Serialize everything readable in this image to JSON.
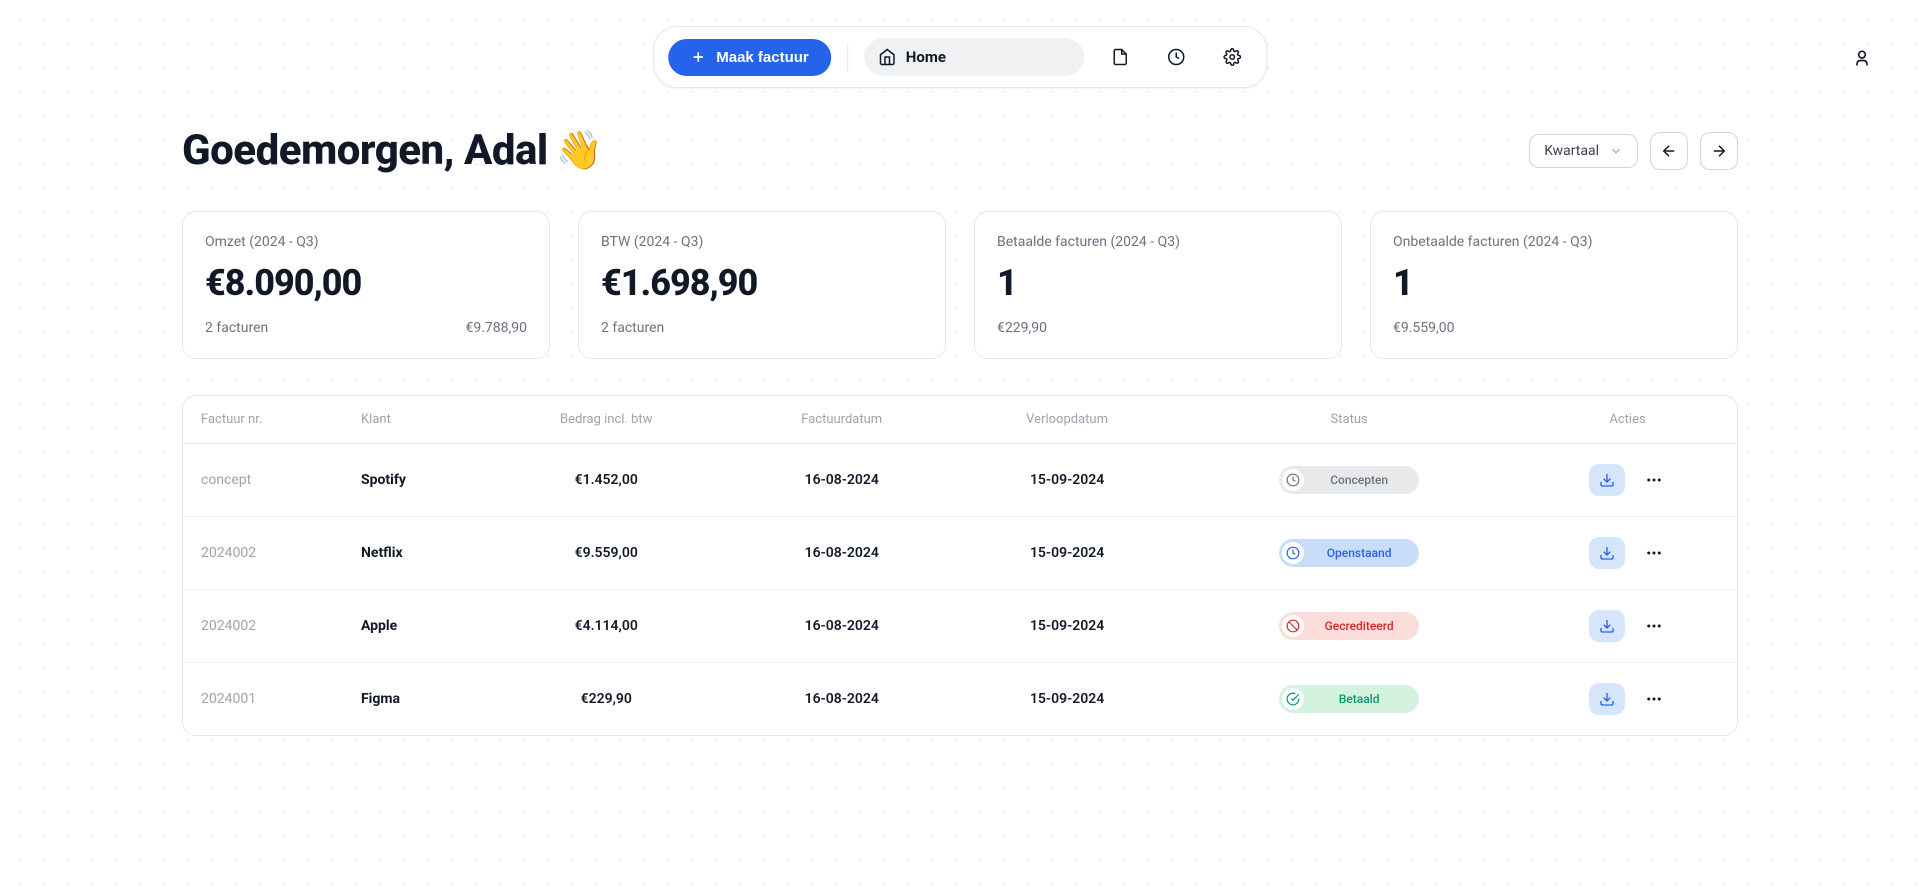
{
  "nav": {
    "create_invoice": "Maak factuur",
    "home": "Home"
  },
  "greeting": {
    "text": "Goedemorgen, Adal",
    "emoji": "👋"
  },
  "period": {
    "label": "Kwartaal"
  },
  "stats": [
    {
      "label": "Omzet (2024 - Q3)",
      "value": "€8.090,00",
      "foot_left": "2 facturen",
      "foot_right": "€9.788,90"
    },
    {
      "label": "BTW (2024 - Q3)",
      "value": "€1.698,90",
      "foot_left": "2 facturen",
      "foot_right": ""
    },
    {
      "label": "Betaalde facturen (2024 - Q3)",
      "value": "1",
      "foot_left": "€229,90",
      "foot_right": ""
    },
    {
      "label": "Onbetaalde facturen (2024 - Q3)",
      "value": "1",
      "foot_left": "€9.559,00",
      "foot_right": ""
    }
  ],
  "table": {
    "headers": {
      "nr": "Factuur nr.",
      "klant": "Klant",
      "bedrag": "Bedrag incl. btw",
      "factuurdatum": "Factuurdatum",
      "verloopdatum": "Verloopdatum",
      "status": "Status",
      "acties": "Acties"
    },
    "rows": [
      {
        "nr": "concept",
        "klant": "Spotify",
        "bedrag": "€1.452,00",
        "fdate": "16-08-2024",
        "vdate": "15-09-2024",
        "status": "Concepten",
        "status_type": "concept"
      },
      {
        "nr": "2024002",
        "klant": "Netflix",
        "bedrag": "€9.559,00",
        "fdate": "16-08-2024",
        "vdate": "15-09-2024",
        "status": "Openstaand",
        "status_type": "open"
      },
      {
        "nr": "2024002",
        "klant": "Apple",
        "bedrag": "€4.114,00",
        "fdate": "16-08-2024",
        "vdate": "15-09-2024",
        "status": "Gecrediteerd",
        "status_type": "credit"
      },
      {
        "nr": "2024001",
        "klant": "Figma",
        "bedrag": "€229,90",
        "fdate": "16-08-2024",
        "vdate": "15-09-2024",
        "status": "Betaald",
        "status_type": "paid"
      }
    ]
  }
}
